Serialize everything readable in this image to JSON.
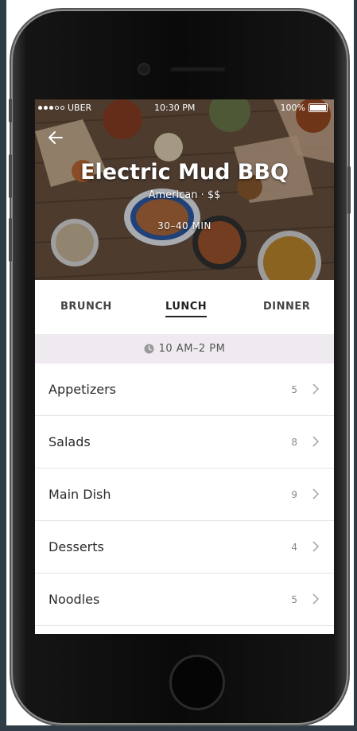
{
  "status_bar": {
    "carrier": "UBER",
    "time": "10:30 PM",
    "battery": "100%"
  },
  "restaurant": {
    "name": "Electric Mud BBQ",
    "cuisine_price": "American · $$",
    "eta": "30–40 MIN"
  },
  "tabs": [
    {
      "label": "BRUNCH",
      "active": false
    },
    {
      "label": "LUNCH",
      "active": true
    },
    {
      "label": "DINNER",
      "active": false
    }
  ],
  "hours": {
    "icon": "clock-icon",
    "text": "10 AM–2 PM"
  },
  "menu": [
    {
      "label": "Appetizers",
      "count": "5"
    },
    {
      "label": "Salads",
      "count": "8"
    },
    {
      "label": "Main Dish",
      "count": "9"
    },
    {
      "label": "Desserts",
      "count": "4"
    },
    {
      "label": "Noodles",
      "count": "5"
    }
  ],
  "colors": {
    "background": "#2f3d47",
    "hours_bar": "#efe9f0",
    "text": "#2b2b2b"
  }
}
